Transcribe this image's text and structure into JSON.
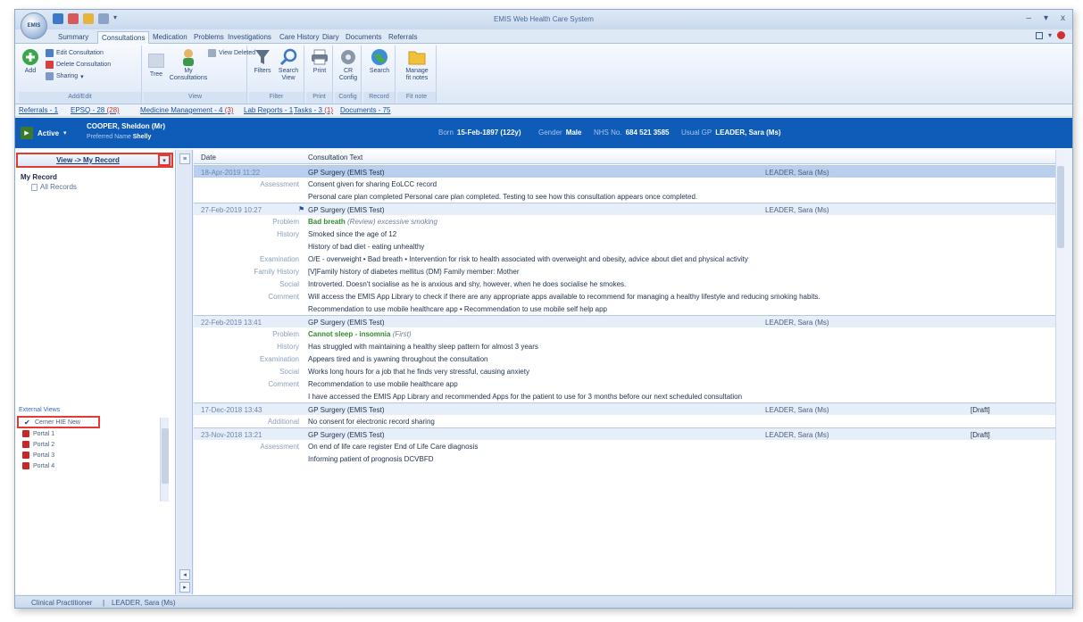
{
  "window": {
    "title": "EMIS Web Health Care System",
    "orb_label": "EMIS",
    "controls": [
      "–",
      "▾",
      "x"
    ]
  },
  "tabs": [
    "Summary",
    "Consultations",
    "Medication",
    "Problems",
    "Investigations",
    "Care History",
    "Diary",
    "Documents",
    "Referrals"
  ],
  "ribbon": {
    "add": "Add",
    "edit_consultation": "Edit Consultation",
    "delete_consultation": "Delete Consultation",
    "sharing": "Sharing",
    "group_addedit": "Add/Edit",
    "tree": "Tree",
    "my_consultations": "My Consultations",
    "view_deleted": "View Deleted",
    "group_view": "View",
    "filters": "Filters",
    "search_view": "Search View",
    "group_filter": "Filter",
    "print": "Print",
    "group_print": "Print",
    "cr_config": "CR Config",
    "group_config": "Config",
    "search": "Search",
    "group_record": "Record",
    "manage_fit_notes": "Manage fit notes",
    "group_fitnote": "Fit note"
  },
  "links": [
    {
      "text": "Referrals - 1",
      "extra": ""
    },
    {
      "text": "EPSQ - 28",
      "extra": "(28)"
    },
    {
      "text": "Medicine Management - 4",
      "extra": "(3)"
    },
    {
      "text": "Lab Reports - 1",
      "extra": ""
    },
    {
      "text": "Tasks - 3",
      "extra": "(1)"
    },
    {
      "text": "Documents - 75",
      "extra": ""
    }
  ],
  "banner": {
    "status": "Active",
    "name": "COOPER, Sheldon (Mr)",
    "preferred_label": "Preferred Name",
    "preferred_value": "Shelly",
    "born_label": "Born",
    "born_value": "15-Feb-1897 (122y)",
    "gender_label": "Gender",
    "gender_value": "Male",
    "nhs_label": "NHS No.",
    "nhs_value": "684 521 3585",
    "gp_label": "Usual GP",
    "gp_value": "LEADER, Sara (Ms)"
  },
  "leftnav": {
    "view_button": "View -> My Record",
    "dropdown": "▾",
    "tree_root": "My Record",
    "tree_child": "All Records",
    "external_views_label": "External Views",
    "external_views": [
      "Cerner HIE New",
      "Portal 1",
      "Portal 2",
      "Portal 3",
      "Portal 4"
    ]
  },
  "grid": {
    "col_date": "Date",
    "col_text": "Consultation Text",
    "consultations": [
      {
        "date": "18-Apr-2019 11:22",
        "place": "GP Surgery (EMIS Test)",
        "user": "LEADER, Sara (Ms)",
        "draft": "",
        "flag": "",
        "lines": [
          {
            "label": "Assessment",
            "text": "Consent given for sharing EoLCC record",
            "style": ""
          },
          {
            "label": "",
            "text": "Personal care plan completed Personal care plan completed. Testing to see how this consultation appears once completed.",
            "style": ""
          }
        ]
      },
      {
        "date": "27-Feb-2019 10:27",
        "place": "GP Surgery (EMIS Test)",
        "user": "LEADER, Sara (Ms)",
        "draft": "",
        "flag": "⚑",
        "lines": [
          {
            "label": "Problem",
            "text": "Bad breath",
            "sub": " (Review) excessive smoking",
            "style": "green"
          },
          {
            "label": "History",
            "text": "Smoked since the age of 12",
            "style": ""
          },
          {
            "label": "",
            "text": "History of bad diet - eating unhealthy",
            "style": ""
          },
          {
            "label": "Examination",
            "text": "O/E - overweight • Bad breath • Intervention for risk to health associated with overweight and obesity, advice about diet and physical activity",
            "style": ""
          },
          {
            "label": "Family History",
            "text": "[V]Family history of diabetes mellitus (DM) Family member: Mother",
            "style": ""
          },
          {
            "label": "Social",
            "text": "Introverted. Doesn't socialise as he is anxious and shy, however, when he does socialise he smokes.",
            "style": ""
          },
          {
            "label": "Comment",
            "text": "Will access the EMIS App Library to check if there are any appropriate apps available to recommend for managing a healthy lifestyle and reducing smoking habits.",
            "style": ""
          },
          {
            "label": "",
            "text": "Recommendation to use mobile healthcare app • Recommendation to use mobile self help app",
            "style": ""
          }
        ]
      },
      {
        "date": "22-Feb-2019 13:41",
        "place": "GP Surgery (EMIS Test)",
        "user": "LEADER, Sara (Ms)",
        "draft": "",
        "flag": "",
        "lines": [
          {
            "label": "Problem",
            "text": "Cannot sleep - insomnia",
            "sub": " (First)",
            "style": "green"
          },
          {
            "label": "History",
            "text": "Has struggled with maintaining a healthy sleep pattern for almost 3 years",
            "style": ""
          },
          {
            "label": "Examination",
            "text": "Appears tired and is yawning throughout the consultation",
            "style": ""
          },
          {
            "label": "Social",
            "text": "Works long hours for a job that he finds very stressful, causing anxiety",
            "style": ""
          },
          {
            "label": "Comment",
            "text": "Recommendation to use mobile healthcare app",
            "style": ""
          },
          {
            "label": "",
            "text": "I have accessed the EMIS App Library and recommended Apps for the patient to use for 3 months before our next scheduled consultation",
            "style": ""
          }
        ]
      },
      {
        "date": "17-Dec-2018 13:43",
        "place": "GP Surgery (EMIS Test)",
        "user": "LEADER, Sara (Ms)",
        "draft": "[Draft]",
        "flag": "",
        "lines": [
          {
            "label": "Additional",
            "text": "No consent for electronic record sharing",
            "style": ""
          }
        ]
      },
      {
        "date": "23-Nov-2018 13:21",
        "place": "GP Surgery (EMIS Test)",
        "user": "LEADER, Sara (Ms)",
        "draft": "[Draft]",
        "flag": "",
        "lines": [
          {
            "label": "Assessment",
            "text": "On end of life care register End of Life Care diagnosis",
            "style": ""
          },
          {
            "label": "",
            "text": "Informing patient of prognosis DCVBFD",
            "style": ""
          }
        ]
      }
    ]
  },
  "statusbar": {
    "role": "Clinical Practitioner",
    "user": "LEADER, Sara (Ms)"
  },
  "colors": {
    "banner": "#0e5bb8",
    "highlight_border": "#e53935",
    "problem_green": "#2e8b2e",
    "link_blue": "#1c4fa0"
  }
}
